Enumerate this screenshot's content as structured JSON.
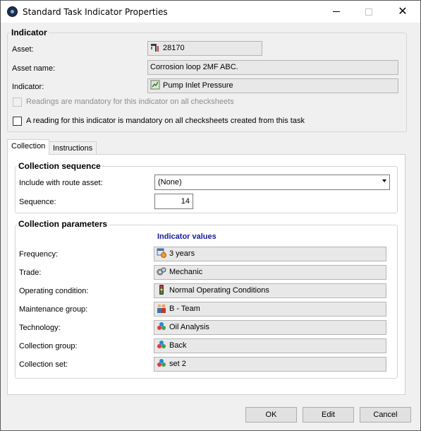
{
  "window": {
    "title": "Standard Task Indicator Properties"
  },
  "indicator": {
    "group_title": "Indicator",
    "asset_label": "Asset:",
    "asset_value": "28170",
    "asset_name_label": "Asset name:",
    "asset_name_value": "Corrosion loop 2MF ABC.",
    "indicator_label": "Indicator:",
    "indicator_value": "Pump Inlet Pressure",
    "readings_mandatory_label": "Readings are mandatory for this indicator on all checksheets",
    "reading_mandatory_task_label": "A reading for this indicator is mandatory on all checksheets created from this task"
  },
  "tabs": [
    {
      "label": "Collection",
      "active": true
    },
    {
      "label": "Instructions",
      "active": false
    }
  ],
  "collection_sequence": {
    "group_title": "Collection sequence",
    "route_label": "Include with route asset:",
    "route_value": "(None)",
    "sequence_label": "Sequence:",
    "sequence_value": "14"
  },
  "collection_parameters": {
    "group_title": "Collection parameters",
    "values_header": "Indicator values",
    "rows": [
      {
        "label": "Frequency:",
        "value": "3 years",
        "icon": "calendar-clock-icon"
      },
      {
        "label": "Trade:",
        "value": "Mechanic",
        "icon": "gears-icon"
      },
      {
        "label": "Operating condition:",
        "value": "Normal Operating Conditions",
        "icon": "traffic-light-icon"
      },
      {
        "label": "Maintenance group:",
        "value": "B - Team",
        "icon": "team-icon"
      },
      {
        "label": "Technology:",
        "value": "Oil Analysis",
        "icon": "colored-balls-icon"
      },
      {
        "label": "Collection group:",
        "value": "Back",
        "icon": "colored-balls-icon"
      },
      {
        "label": "Collection set:",
        "value": "set 2",
        "icon": "colored-balls-icon"
      }
    ]
  },
  "buttons": {
    "ok": "OK",
    "edit": "Edit",
    "cancel": "Cancel"
  },
  "colors": {
    "accent_header": "#1a1aa0",
    "window_bg": "#f0f0f0"
  }
}
